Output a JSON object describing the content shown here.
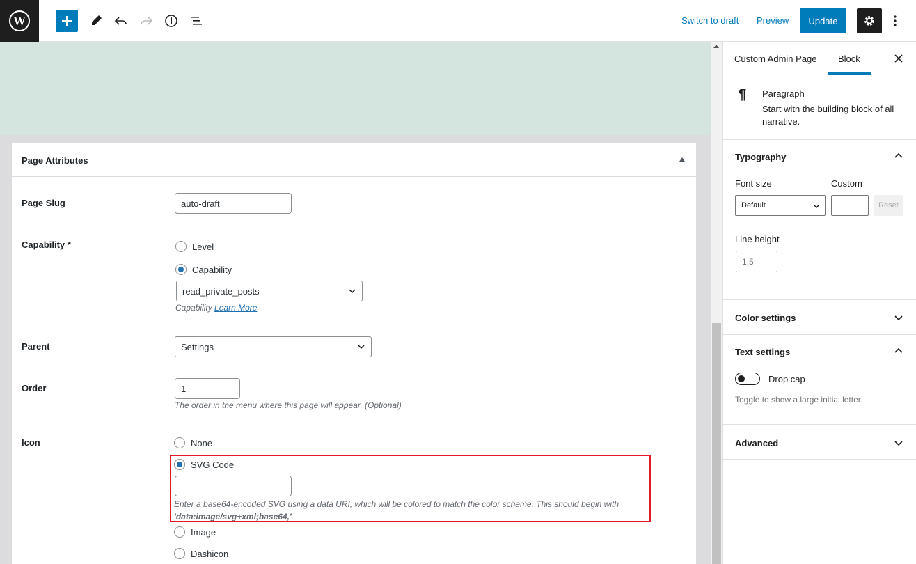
{
  "toolbar": {
    "switch_to_draft": "Switch to draft",
    "preview": "Preview",
    "update": "Update"
  },
  "metabox": {
    "title": "Page Attributes",
    "page_slug": {
      "label": "Page Slug",
      "value": "auto-draft"
    },
    "capability": {
      "label": "Capability *",
      "options": [
        "Level",
        "Capability"
      ],
      "selected": "Capability",
      "select_value": "read_private_posts",
      "help_prefix": "Capability",
      "help_link": "Learn More"
    },
    "parent": {
      "label": "Parent",
      "value": "Settings"
    },
    "order": {
      "label": "Order",
      "value": "1",
      "help": "The order in the menu where this page will appear. (Optional)"
    },
    "icon": {
      "label": "Icon",
      "options": [
        "None",
        "SVG Code",
        "Image",
        "Dashicon"
      ],
      "selected": "SVG Code",
      "svg_value": "",
      "help_line1": "Enter a base64-encoded SVG using a data URI, which will be colored to match the color scheme. This should begin with",
      "help_code": "'data:image/svg+xml;base64,'",
      "help_end": "."
    }
  },
  "sidebar": {
    "tabs": [
      "Custom Admin Page",
      "Block"
    ],
    "active_tab": "Block",
    "block": {
      "title": "Paragraph",
      "description": "Start with the building block of all narrative."
    },
    "typography": {
      "title": "Typography",
      "font_size_label": "Font size",
      "custom_label": "Custom",
      "font_size_value": "Default",
      "custom_value": "",
      "reset": "Reset",
      "line_height_label": "Line height",
      "line_height_placeholder": "1.5"
    },
    "color_settings": "Color settings",
    "text_settings": {
      "title": "Text settings",
      "drop_cap": "Drop cap",
      "help": "Toggle to show a large initial letter."
    },
    "advanced": "Advanced"
  },
  "colors": {
    "accent": "#007cba",
    "highlight": "#e01b24",
    "canvas": "#d4e4df"
  }
}
